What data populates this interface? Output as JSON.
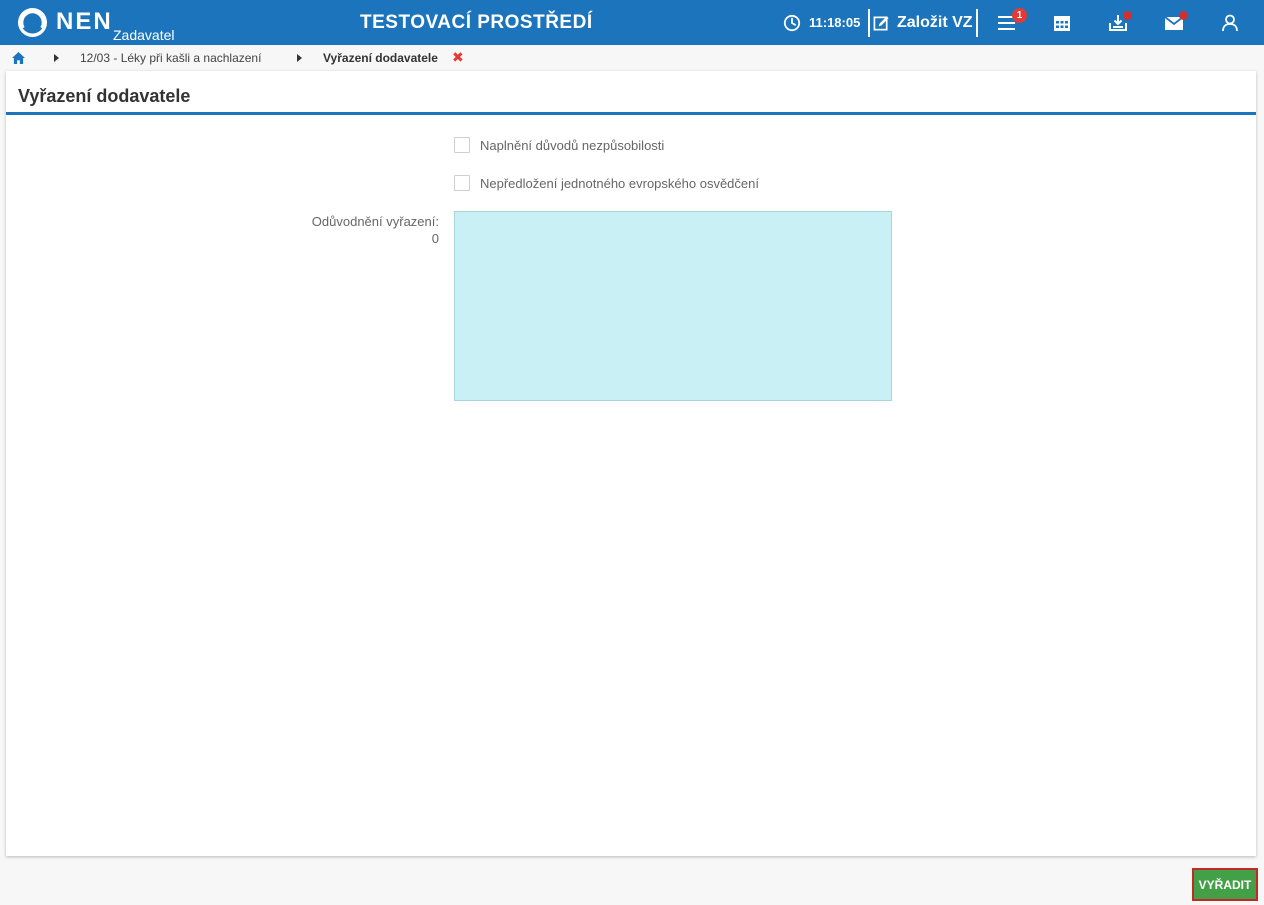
{
  "header": {
    "brand": "NEN",
    "brand_sub": "Zadavatel",
    "environment_title": "TESTOVACÍ PROSTŘEDÍ",
    "clock": "11:18:05",
    "create_label": "Založit VZ",
    "notifications_count": "1",
    "icons": [
      "clock-icon",
      "edit-icon",
      "menu-icon",
      "calendar-icon",
      "inbox-download-icon",
      "mail-icon",
      "user-icon"
    ],
    "accent_color": "#1c75bc"
  },
  "breadcrumb": {
    "items": [
      "12/03 - Léky při kašli a nachlazení"
    ],
    "current": "Vyřazení dodavatele",
    "close_glyph": "✖"
  },
  "form": {
    "title": "Vyřazení dodavatele",
    "checkboxes": [
      {
        "label": "Naplnění důvodů nezpůsobilosti",
        "checked": false
      },
      {
        "label": "Nepředložení jednotného evropského osvědčení",
        "checked": false
      }
    ],
    "reason_label": "Odůvodnění vyřazení:",
    "reason_count": "0",
    "reason_value": ""
  },
  "actions": {
    "submit_label": "VYŘADIT",
    "submit_color": "#43a047"
  }
}
